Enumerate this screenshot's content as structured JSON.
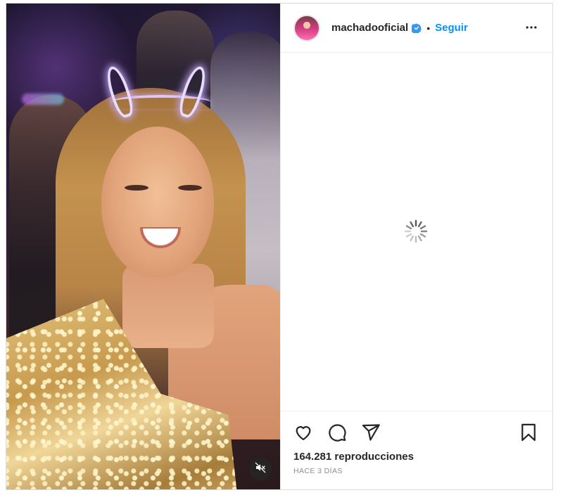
{
  "post": {
    "username": "machadooficial",
    "verified": true,
    "separator": "•",
    "follow_label": "Seguir",
    "views_text": "164.281 reproducciones",
    "time_ago": "HACE 3 DÍAS"
  },
  "icons": {
    "verified": "verified-badge-icon",
    "more": "more-options-icon",
    "spinner": "loading-spinner-icon",
    "like": "heart-icon",
    "comment": "comment-icon",
    "share": "paper-plane-icon",
    "save": "bookmark-icon",
    "mute": "muted-speaker-icon"
  },
  "colors": {
    "follow": "#0095f6",
    "verified": "#3897f0",
    "text": "#262626",
    "muted_text": "#8e8e8e",
    "border": "#dbdbdb"
  }
}
